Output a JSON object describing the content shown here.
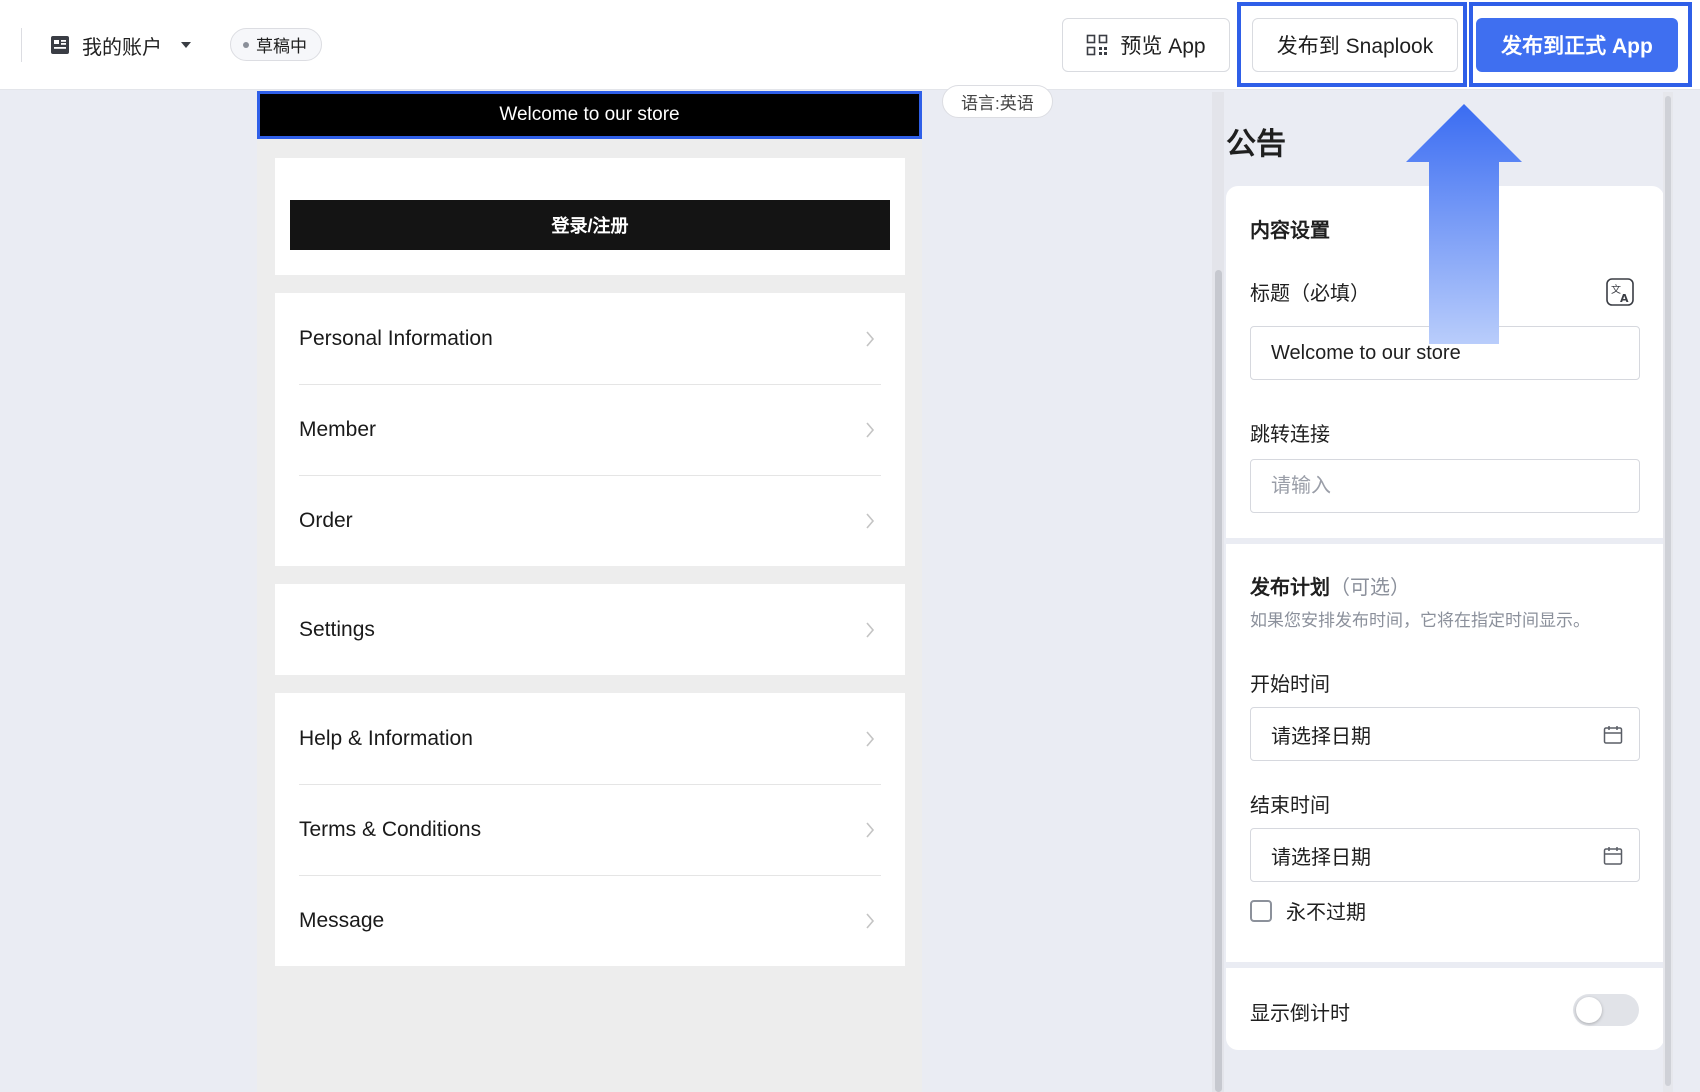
{
  "topbar": {
    "account_name": "我的账户",
    "status_badge": "草稿中",
    "preview_label": "预览 App",
    "publish_snaplook_label": "发布到 Snaplook",
    "publish_app_label": "发布到正式 App"
  },
  "preview": {
    "announcement_text": "Welcome to our store",
    "login_label": "登录/注册",
    "language_badge": "语言:英语",
    "menu_groups": [
      [
        "Personal Information",
        "Member",
        "Order"
      ],
      [
        "Settings"
      ],
      [
        "Help & Information",
        "Terms & Conditions",
        "Message"
      ]
    ]
  },
  "panel": {
    "title": "公告",
    "content_section": {
      "heading": "内容设置",
      "title_label": "标题（必填）",
      "title_value": "Welcome to our store",
      "link_label": "跳转连接",
      "link_placeholder": "请输入"
    },
    "schedule_section": {
      "heading": "发布计划",
      "optional": "（可选）",
      "hint": "如果您安排发布时间，它将在指定时间显示。",
      "start_label": "开始时间",
      "start_placeholder": "请选择日期",
      "end_label": "结束时间",
      "end_placeholder": "请选择日期",
      "never_expire_label": "永不过期"
    },
    "countdown_section": {
      "label": "显示倒计时",
      "enabled": false
    }
  },
  "colors": {
    "primary": "#3f6ff0",
    "highlight": "#2f5fe8",
    "canvas": "#eaecf3"
  },
  "icons": {
    "account": "document-icon",
    "dropdown": "caret-down-icon",
    "preview": "qr-code-icon",
    "translate": "translate-icon",
    "calendar": "calendar-icon",
    "menu_chevron": "chevron-right-icon"
  }
}
